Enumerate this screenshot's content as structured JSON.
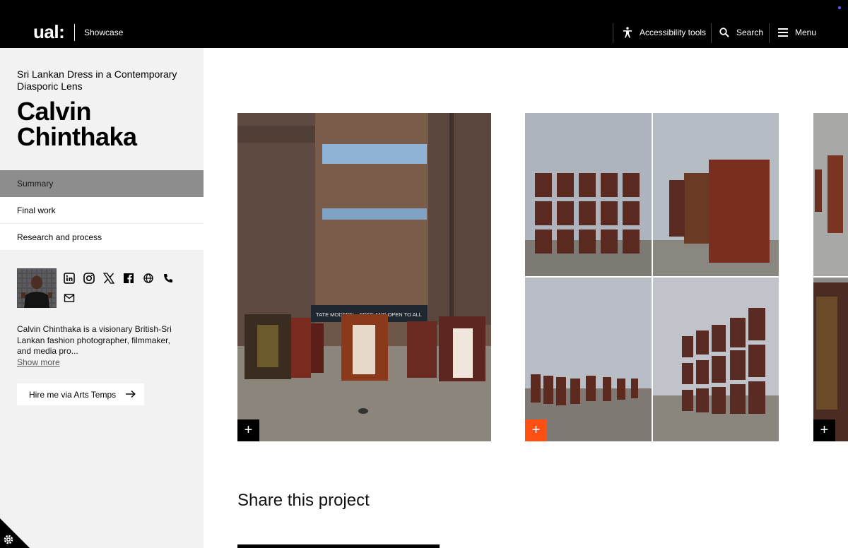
{
  "header": {
    "logo": "ual:",
    "section": "Showcase",
    "accessibility_label": "Accessibility tools",
    "search_label": "Search",
    "menu_label": "Menu"
  },
  "project": {
    "title": "Sri Lankan Dress in a Contemporary Diasporic Lens",
    "student_name": "Calvin Chinthaka"
  },
  "nav": {
    "items": [
      {
        "label": "Summary",
        "active": true
      },
      {
        "label": "Final work",
        "active": false
      },
      {
        "label": "Research and process",
        "active": false
      }
    ]
  },
  "profile": {
    "social_icons": [
      "linkedin-icon",
      "instagram-icon",
      "x-icon",
      "facebook-icon",
      "globe-icon",
      "phone-icon",
      "mail-icon"
    ],
    "bio": "Calvin Chinthaka is a visionary British-Sri Lankan fashion photographer, filmmaker, and media pro...",
    "show_more": "Show more",
    "hire_label": "Hire me via Arts Temps"
  },
  "gallery": {
    "banner_text": "TATE MODERN – FREE AND OPEN TO ALL",
    "expand_symbol": "+"
  },
  "share": {
    "title": "Share this project"
  },
  "colors": {
    "accent": "#ff4f12",
    "header_bg": "#000000",
    "sidebar_bg": "#f2f2f2",
    "active_nav": "#8d8d8d"
  }
}
